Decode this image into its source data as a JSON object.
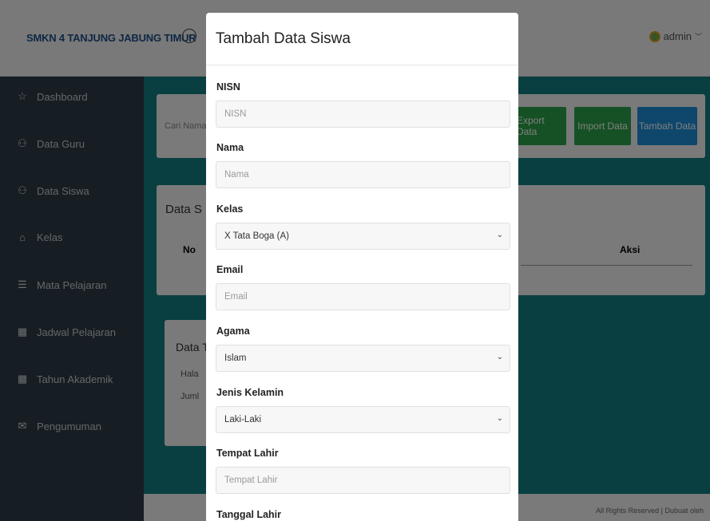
{
  "header": {
    "brand": "SMKN 4 TANJUNG JABUNG TIMUR",
    "user": "admin"
  },
  "sidebar": {
    "items": [
      {
        "label": "Dashboard",
        "icon": "star-icon"
      },
      {
        "label": "Data Guru",
        "icon": "users-icon"
      },
      {
        "label": "Data Siswa",
        "icon": "users-icon"
      },
      {
        "label": "Kelas",
        "icon": "home-icon"
      },
      {
        "label": "Mata Pelajaran",
        "icon": "database-icon"
      },
      {
        "label": "Jadwal Pelajaran",
        "icon": "calendar-icon"
      },
      {
        "label": "Tahun Akademik",
        "icon": "calendar-icon"
      },
      {
        "label": "Pengumuman",
        "icon": "mail-icon"
      }
    ]
  },
  "main": {
    "search_placeholder": "Cari Nama",
    "buttons": {
      "export": "Export Data",
      "import": "Import Data",
      "add": "Tambah Data"
    },
    "table": {
      "title_partial": "Data S",
      "col_no": "No",
      "col_aksi": "Aksi"
    },
    "info": {
      "title_partial": "Data Ta",
      "line1_partial": "Hala",
      "line2_partial": "Juml"
    },
    "footer_partial": "All Rights Reserved | Dubuat oleh"
  },
  "modal": {
    "title": "Tambah Data Siswa",
    "fields": {
      "nisn": {
        "label": "NISN",
        "placeholder": "NISN"
      },
      "nama": {
        "label": "Nama",
        "placeholder": "Nama"
      },
      "kelas": {
        "label": "Kelas",
        "value": "X Tata Boga (A)"
      },
      "email": {
        "label": "Email",
        "placeholder": "Email"
      },
      "agama": {
        "label": "Agama",
        "value": "Islam"
      },
      "jenis_kelamin": {
        "label": "Jenis Kelamin",
        "value": "Laki-Laki"
      },
      "tempat_lahir": {
        "label": "Tempat Lahir",
        "placeholder": "Tempat Lahir"
      },
      "tanggal_lahir": {
        "label": "Tanggal Lahir"
      }
    }
  }
}
